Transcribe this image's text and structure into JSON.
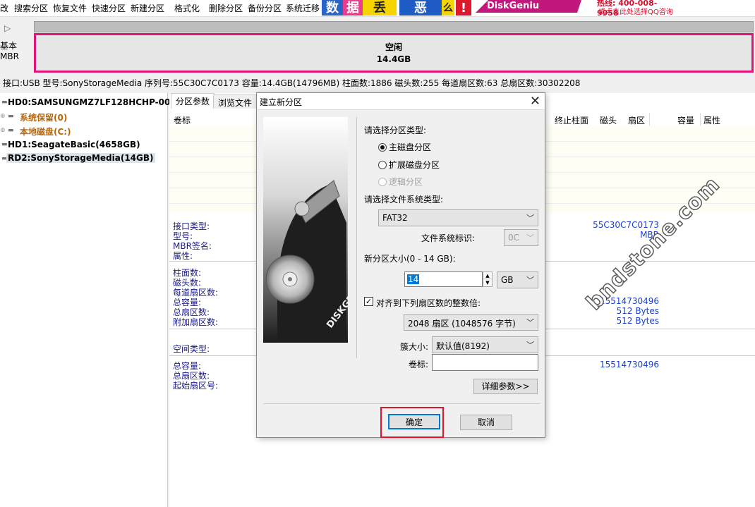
{
  "toolbar": {
    "items": [
      "改",
      "搜索分区",
      "恢复文件",
      "快速分区",
      "新建分区",
      "格式化",
      "删除分区",
      "备份分区",
      "系统迁移"
    ]
  },
  "banner": {
    "chars": [
      "数",
      "据",
      "丢",
      "恶",
      "么",
      "!"
    ],
    "brand": "DiskGeniu",
    "hotline": "热线: 400-008-9958",
    "qq": "或点击此处选择QQ咨询"
  },
  "disk_map": {
    "label_line1": "基本",
    "label_line2": "MBR",
    "block_name": "空闲",
    "block_size": "14.4GB"
  },
  "disk_info": "接口:USB  型号:SonyStorageMedia  序列号:55C30C7C0173  容量:14.4GB(14796MB)  柱面数:1886  磁头数:255  每道扇区数:63  总扇区数:30302208",
  "tree": {
    "items": [
      {
        "label": "HD0:SAMSUNGMZ7LF128HCHP-0000"
      },
      {
        "label": "系统保留(0)"
      },
      {
        "label": "本地磁盘(C:)"
      },
      {
        "label": "HD1:SeagateBasic(4658GB)"
      },
      {
        "label": "RD2:SonyStorageMedia(14GB)"
      }
    ]
  },
  "tabs": [
    "分区参数",
    "浏览文件"
  ],
  "columns": [
    "卷标",
    "终止柱面",
    "磁头",
    "扇区",
    "容量",
    "属性"
  ],
  "details": {
    "labels1": [
      "接口类型:",
      "型号:",
      "MBR签名:",
      "属性:"
    ],
    "labels2": [
      "柱面数:",
      "磁头数:",
      "每道扇区数:",
      "总容量:",
      "总扇区数:",
      "附加扇区数:"
    ],
    "labels3": [
      "空间类型:"
    ],
    "labels4": [
      "总容量:",
      "总扇区数:",
      "起始扇区号:"
    ],
    "values": [
      "55C30C7C0173",
      "MBR",
      "15514730496",
      "512 Bytes",
      "512 Bytes",
      "15514730496"
    ]
  },
  "dialog": {
    "title": "建立新分区",
    "img_text": "DISKGENIUS",
    "type_prompt": "请选择分区类型:",
    "radio_primary": "主磁盘分区",
    "radio_extended": "扩展磁盘分区",
    "radio_logical": "逻辑分区",
    "fs_prompt": "请选择文件系统类型:",
    "fs_value": "FAT32",
    "fs_id_label": "文件系统标识:",
    "fs_id_value": "0C",
    "size_prompt": "新分区大小(0 - 14 GB):",
    "size_value": "14",
    "size_unit": "GB",
    "align_label": "对齐到下列扇区数的整数倍:",
    "align_value": "2048 扇区 (1048576 字节)",
    "cluster_label": "簇大小:",
    "cluster_value": "默认值(8192)",
    "volume_label": "卷标:",
    "volume_value": "",
    "advanced_button": "详细参数>>",
    "ok_button": "确定",
    "cancel_button": "取消"
  },
  "watermark": "bndstone.com"
}
